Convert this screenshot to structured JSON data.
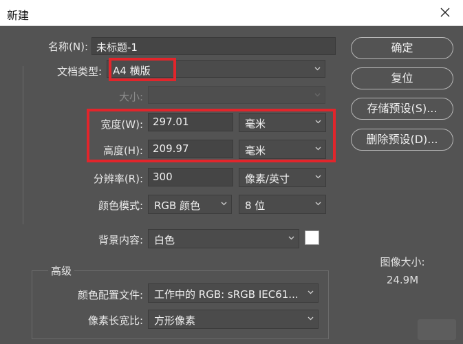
{
  "window": {
    "title": "新建",
    "close_icon": "close-icon"
  },
  "form": {
    "name": {
      "label": "名称(N):",
      "value": "未标题-1"
    },
    "doc_type": {
      "label": "文档类型:",
      "value": "A4 横版"
    },
    "size": {
      "label": "大小:",
      "value": ""
    },
    "width": {
      "label": "宽度(W):",
      "value": "297.01",
      "unit": "毫米"
    },
    "height": {
      "label": "高度(H):",
      "value": "209.97",
      "unit": "毫米"
    },
    "resolution": {
      "label": "分辨率(R):",
      "value": "300",
      "unit": "像素/英寸"
    },
    "color_mode": {
      "label": "颜色模式:",
      "value": "RGB 颜色",
      "bits": "8 位"
    },
    "background": {
      "label": "背景内容:",
      "value": "白色",
      "swatch_color": "#ffffff"
    }
  },
  "advanced": {
    "title": "高级",
    "color_profile": {
      "label": "颜色配置文件:",
      "value": "工作中的 RGB: sRGB IEC61..."
    },
    "pixel_aspect": {
      "label": "像素长宽比:",
      "value": "方形像素"
    }
  },
  "buttons": {
    "ok": "确定",
    "reset": "复位",
    "save_preset": "存储预设(S)...",
    "delete_preset": "删除预设(D)..."
  },
  "image_size": {
    "label": "图像大小:",
    "value": "24.9M"
  },
  "colors": {
    "background": "#535353",
    "highlight": "#e2252b"
  }
}
